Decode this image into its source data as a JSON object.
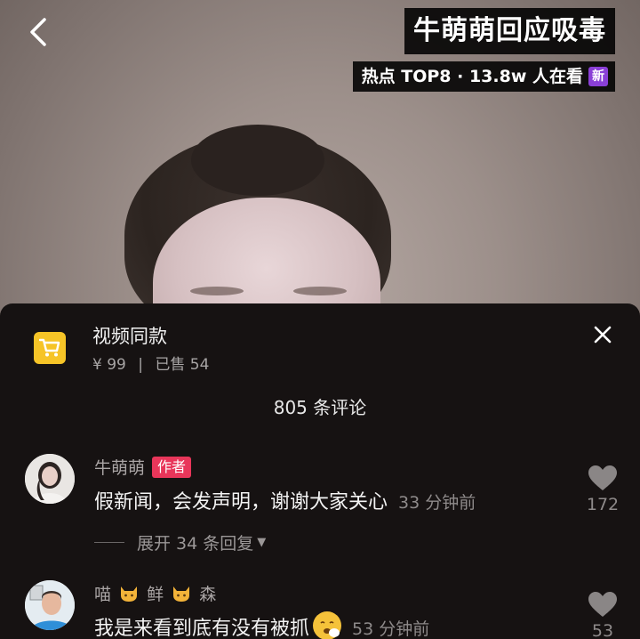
{
  "header": {
    "title": "牛萌萌回应吸毒",
    "hot_label": "热点 TOP8 · 13.8w 人在看",
    "new_badge": "新"
  },
  "product": {
    "title": "视频同款",
    "price": "¥ 99",
    "separator": "|",
    "sold": "已售 54",
    "icon": "cart-icon"
  },
  "comments_header": {
    "count_label": "805 条评论"
  },
  "comments": [
    {
      "username": "牛萌萌",
      "tag": "作者",
      "text": "假新闻，会发声明，谢谢大家关心",
      "time": "33 分钟前",
      "likes": "172",
      "expand_label": "展开 34 条回复"
    },
    {
      "username_parts": [
        "喵",
        "鲜",
        "森"
      ],
      "username_icon": "cat-emoji-icon",
      "text": "我是来看到底有没有被抓",
      "emoji": "sneezing-face-emoji",
      "time": "53 分钟前",
      "likes": "53"
    }
  ],
  "colors": {
    "author_tag": "#e8365a",
    "new_badge": "#8a3fd6",
    "cart_bg": "#f6c427",
    "sheet_bg": "#161212"
  }
}
